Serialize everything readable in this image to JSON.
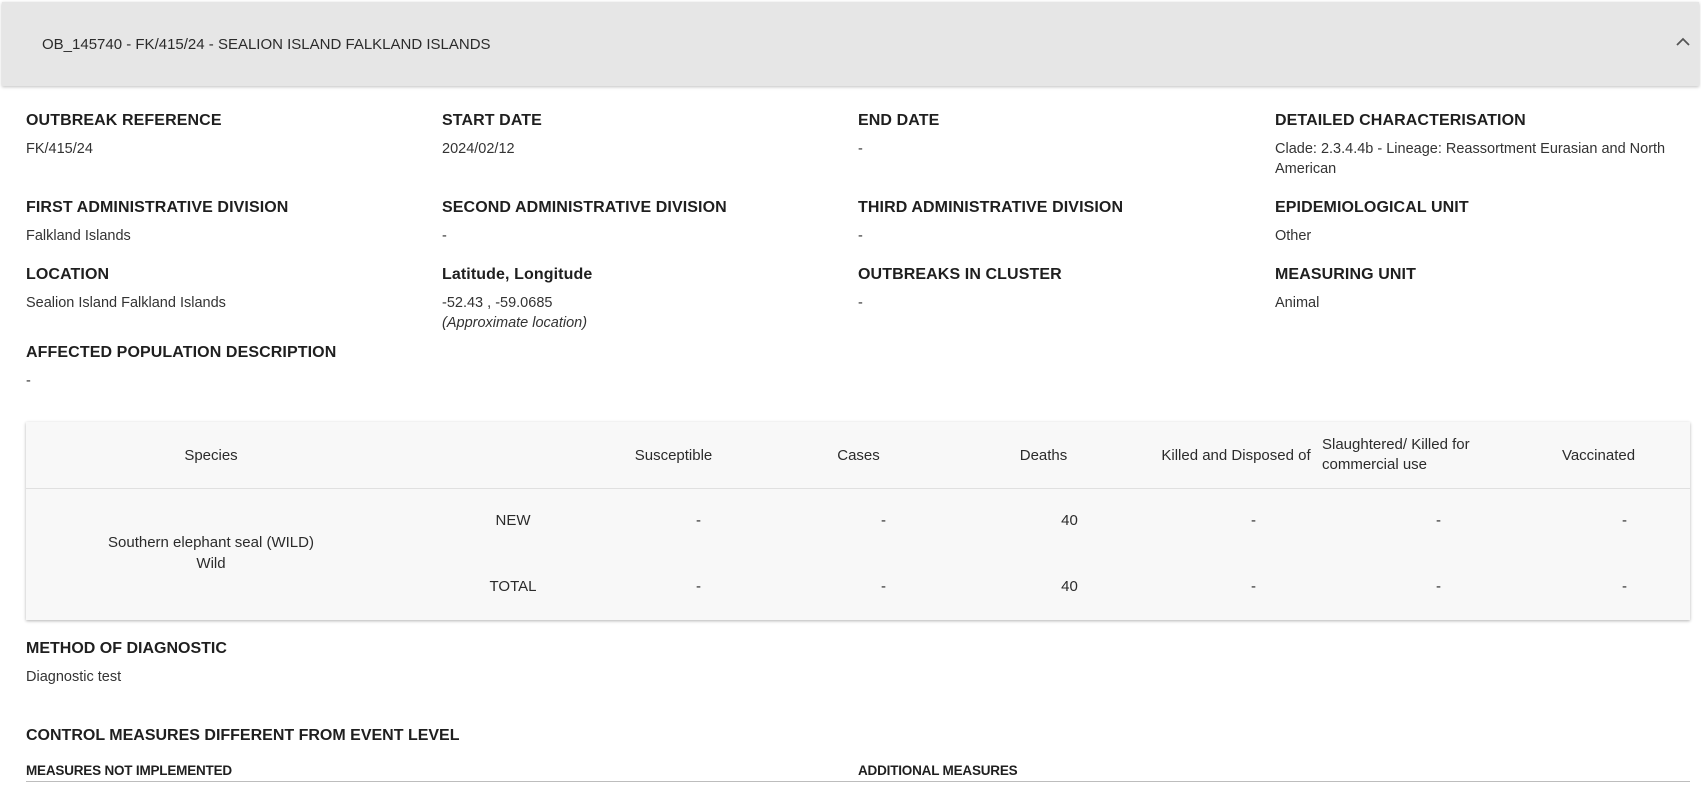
{
  "header": {
    "title": "OB_145740 - FK/415/24 - SEALION ISLAND FALKLAND ISLANDS",
    "toggle_icon": "chevron-up-icon"
  },
  "fields": {
    "outbreak_reference": {
      "label": "OUTBREAK REFERENCE",
      "value": "FK/415/24"
    },
    "start_date": {
      "label": "START DATE",
      "value": "2024/02/12"
    },
    "end_date": {
      "label": "END DATE",
      "value": "-"
    },
    "detailed_characterisation": {
      "label": "DETAILED CHARACTERISATION",
      "value_line1": "Clade: 2.3.4.4b - Lineage: Reassortment Eurasian and North",
      "value_line2": "American"
    },
    "first_admin_division": {
      "label": "FIRST ADMINISTRATIVE DIVISION",
      "value": "Falkland Islands"
    },
    "second_admin_division": {
      "label": "SECOND ADMINISTRATIVE DIVISION",
      "value": "-"
    },
    "third_admin_division": {
      "label": "THIRD ADMINISTRATIVE DIVISION",
      "value": "-"
    },
    "epidemiological_unit": {
      "label": "EPIDEMIOLOGICAL UNIT",
      "value": "Other"
    },
    "location": {
      "label": "LOCATION",
      "value": "Sealion Island Falkland Islands"
    },
    "lat_long": {
      "label": "Latitude, Longitude",
      "value": "-52.43 , -59.0685",
      "note": "(Approximate location)"
    },
    "outbreaks_in_cluster": {
      "label": "OUTBREAKS IN CLUSTER",
      "value": "-"
    },
    "measuring_unit": {
      "label": "MEASURING UNIT",
      "value": "Animal"
    },
    "affected_population": {
      "label": "AFFECTED POPULATION DESCRIPTION",
      "value": "-"
    }
  },
  "table": {
    "headers": {
      "species": "Species",
      "susceptible": "Susceptible",
      "cases": "Cases",
      "deaths": "Deaths",
      "killed": "Killed and Disposed of",
      "slaughtered_line1": "Slaughtered/ Killed for",
      "slaughtered_line2": "commercial use",
      "vaccinated": "Vaccinated"
    },
    "species_line1": "Southern elephant seal (WILD)",
    "species_line2": "Wild",
    "rows": [
      {
        "type": "NEW",
        "susceptible": "-",
        "cases": "-",
        "deaths": "40",
        "killed": "-",
        "slaughtered": "-",
        "vaccinated": "-"
      },
      {
        "type": "TOTAL",
        "susceptible": "-",
        "cases": "-",
        "deaths": "40",
        "killed": "-",
        "slaughtered": "-",
        "vaccinated": "-"
      }
    ]
  },
  "diagnostic": {
    "label": "METHOD OF DIAGNOSTIC",
    "value": "Diagnostic test"
  },
  "control_measures": {
    "label": "CONTROL MEASURES DIFFERENT FROM EVENT LEVEL",
    "not_implemented_label": "MEASURES NOT IMPLEMENTED",
    "additional_label": "ADDITIONAL MEASURES"
  }
}
